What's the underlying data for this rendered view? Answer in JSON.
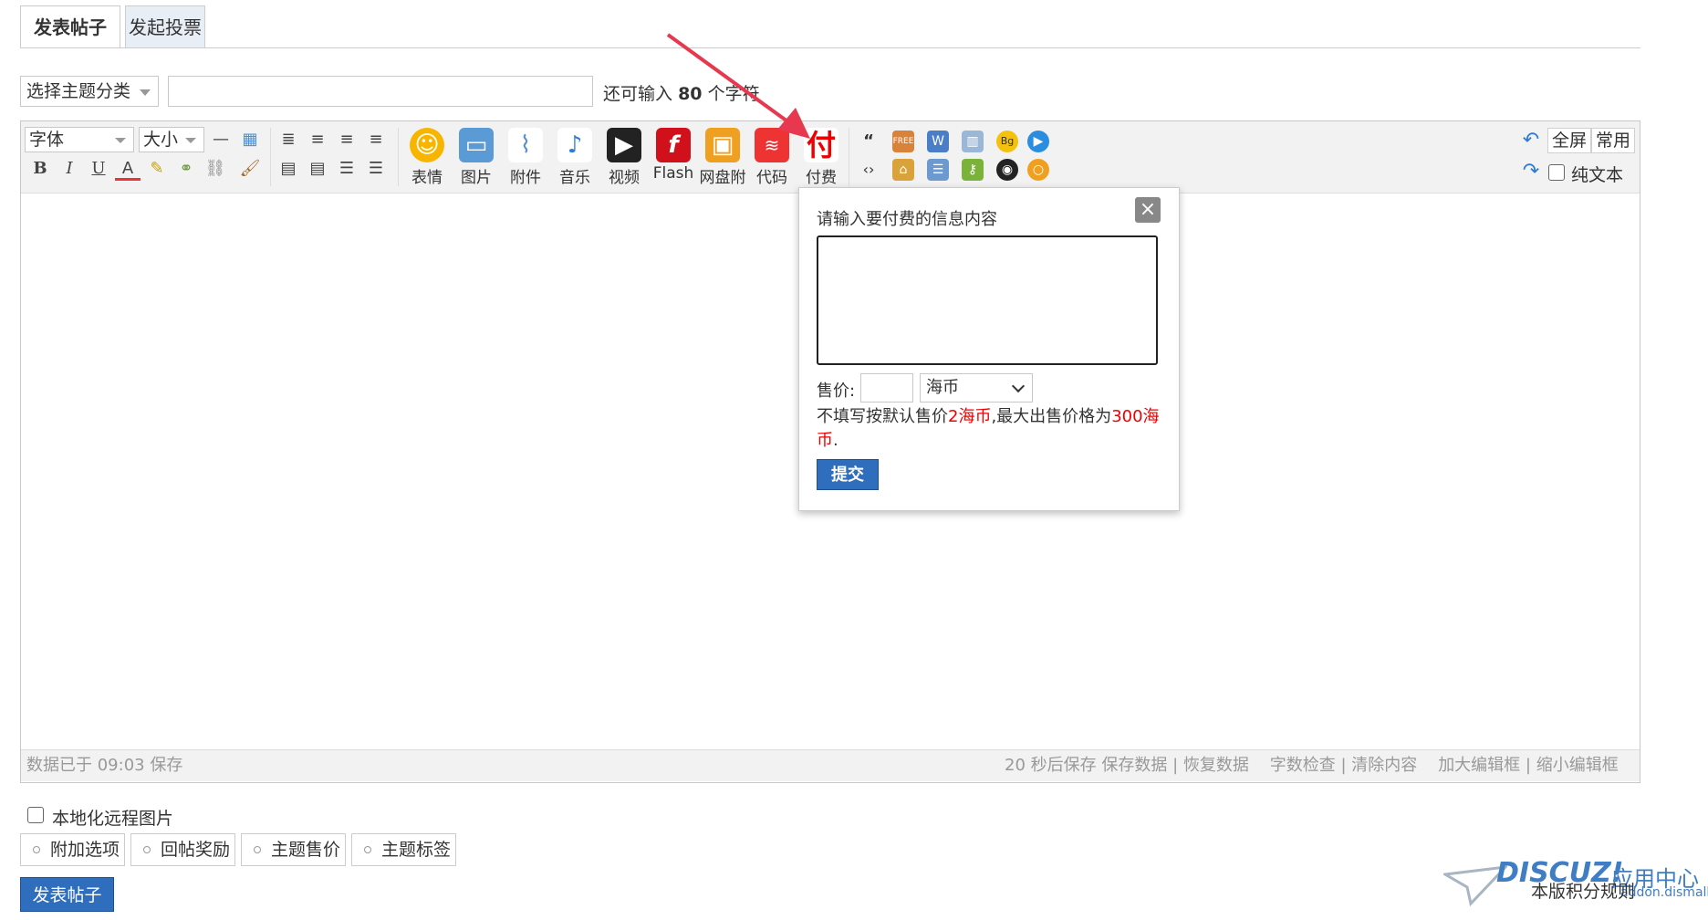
{
  "tabs": {
    "post": "发表帖子",
    "vote": "发起投票"
  },
  "subject": {
    "category": "选择主题分类",
    "remain_prefix": "还可输入",
    "remain_count": "80",
    "remain_suffix": "个字符"
  },
  "toolbar": {
    "font": "字体",
    "size": "大小",
    "style_buttons": [
      "B",
      "I",
      "U",
      "A"
    ],
    "big_buttons": [
      "表情",
      "图片",
      "附件",
      "音乐",
      "视频",
      "Flash",
      "网盘附",
      "代码",
      "付费"
    ],
    "fullscreen": "全屏",
    "common": "常用",
    "plain_text": "纯文本"
  },
  "status": {
    "saved": "数据已于 09:03 保存",
    "autosave": "20 秒后保存",
    "links": [
      "保存数据",
      "恢复数据",
      "字数检查",
      "清除内容",
      "加大编辑框",
      "缩小编辑框"
    ]
  },
  "popup": {
    "title": "请输入要付费的信息内容",
    "close": "×",
    "price_label": "售价:",
    "currency": "海币",
    "note_1": "不填写按默认售价",
    "note_default": "2海币",
    "note_2": ",最大出售价格为",
    "note_max": "300海币",
    "note_end": ".",
    "submit": "提交"
  },
  "bottom": {
    "localize_images": "本地化远程图片",
    "options": [
      "附加选项",
      "回帖奖励",
      "主题售价",
      "主题标签"
    ],
    "post_button": "发表帖子",
    "rules": "本版积分规则",
    "logo": "DISCUZ!",
    "logo_app": "应用中心",
    "logo_url": "addon.dismall.com"
  },
  "colors": {
    "accent": "#2f6dbd",
    "price_red": "#e00000",
    "arrow_red": "#e8384f"
  }
}
